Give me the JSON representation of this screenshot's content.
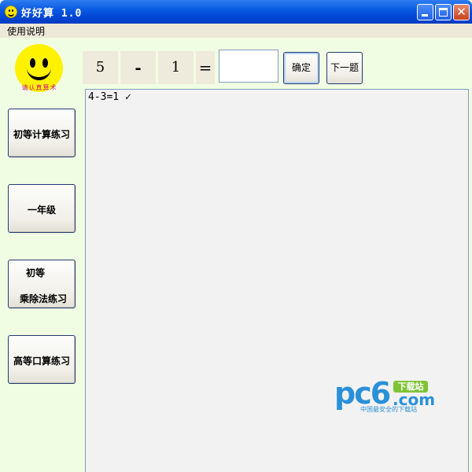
{
  "window": {
    "title": "好好算   1.0",
    "close_glyph": "✕",
    "icons": [
      "smiley-app-icon",
      "minimize-icon",
      "maximize-icon",
      "close-icon"
    ]
  },
  "menu": {
    "items": [
      "使用说明"
    ]
  },
  "logo": {
    "caption": "请认真算术",
    "icon": "smiley-face-icon",
    "color": "#fff200"
  },
  "sidebar": {
    "buttons": [
      {
        "label": "初等计算练习"
      },
      {
        "label": "一年级"
      },
      {
        "label_line1": "初等",
        "label_line2": "乘除法练习"
      },
      {
        "label": "高等口算练习"
      }
    ]
  },
  "equation": {
    "operand1": "5",
    "operator": "-",
    "operand2": "1",
    "equals": "=",
    "answer_value": "",
    "confirm_label": "确定",
    "next_label": "下一题"
  },
  "results": {
    "lines": [
      "4-3=1 ✓"
    ]
  },
  "watermark": {
    "brand": "pc6",
    "badge": "下载站",
    "domain": ".com",
    "tagline": "中国最安全的下载站"
  },
  "colors": {
    "titlebar": "#0054e3",
    "background": "#f1fde3",
    "menubar": "#ece9d8",
    "button_border": "#223a72",
    "watermark": "#2a90d8",
    "badge": "#7ec435"
  }
}
